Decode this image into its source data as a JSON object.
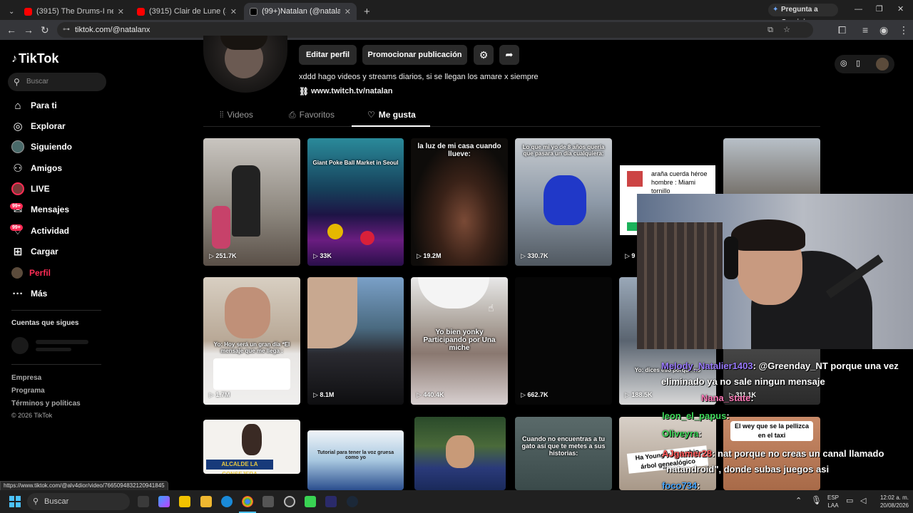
{
  "browser": {
    "tabs": [
      {
        "title": "(3915) The Drums-I need a Do..."
      },
      {
        "title": "(3915) Clair de Lune (Studio Ve..."
      },
      {
        "title": "(99+)Natalan (@natalanx) | TikT..."
      }
    ],
    "new_tab": "+",
    "gemini": "Pregunta a Gemini",
    "url": "tiktok.com/@natalanx"
  },
  "tiktok": {
    "logo": "TikTok",
    "search_placeholder": "Buscar",
    "nav": [
      "Para ti",
      "Explorar",
      "Siguiendo",
      "Amigos",
      "LIVE",
      "Mensajes",
      "Actividad",
      "Cargar",
      "Perfil",
      "Más"
    ],
    "badge": "99+",
    "following_title": "Cuentas que sigues",
    "footer": [
      "Empresa",
      "Programa",
      "Términos y políticas",
      "© 2026 TikTok"
    ]
  },
  "profile": {
    "edit": "Editar perfil",
    "promote": "Promocionar publicación",
    "bio": "xddd hago videos y streams diarios, si se llegan los amare x siempre",
    "link": "www.twitch.tv/natalan",
    "tabs": [
      "Videos",
      "Favoritos",
      "Me gusta"
    ]
  },
  "grid": {
    "row1": [
      {
        "v": "251.7K",
        "cap": ""
      },
      {
        "v": "33K",
        "cap": "Giant Poke Ball Market in Seoul"
      },
      {
        "v": "19.2M",
        "cap": "la luz de mi casa cuando llueve:"
      },
      {
        "v": "330.7K",
        "cap": "Lo que mi yo de 8 años quería que pasara un día cualquiera:"
      },
      {
        "v": "9",
        "cap": "araña cuerda héroe hombre : Miami tornillo"
      }
    ],
    "row2": [
      {
        "v": "1.7M",
        "cap": "Yo: Hoy será un gran día *El mensaje que me llega :"
      },
      {
        "v": "8.1M",
        "cap": ""
      },
      {
        "v": "440.4K",
        "cap": "Yo bien yonky Participando por Una miche"
      },
      {
        "v": "662.7K",
        "cap": ""
      },
      {
        "v": "188.5K",
        "cap": "Yo: dices eso porque no"
      },
      {
        "v": "311.1K",
        "cap": ""
      }
    ],
    "row3": [
      {
        "cap": "ALCALDE LA CONSEJERA"
      },
      {
        "cap": "Tutorial para tener la voz gruesa como yo"
      },
      {
        "cap": ""
      },
      {
        "cap": "Cuando no encuentras a tu gato así que te metes a sus historias:"
      },
      {
        "cap": "Ha Young y su turbio árbol genealógico"
      },
      {
        "cap": "El wey que se la pellizca en el taxi"
      }
    ]
  },
  "chat": [
    {
      "user": "Melody_Natalier1403",
      "text": ": @Greenday_NT porque una vez eliminado ya no sale ningun mensaje"
    },
    {
      "user": "Nana_state",
      "text": ":"
    },
    {
      "user": "leon_el_papus",
      "text": ":"
    },
    {
      "user": "Oliveyra",
      "text": ":"
    },
    {
      "user": "AJgamer28",
      "text": ": nat porque no creas un canal llamado \"natandroid\", donde subas juegos asi"
    },
    {
      "user": "foco734",
      "text": ":"
    }
  ],
  "status_url": "https://www.tiktok.com/@alv4dior/video/7665094832120941845",
  "taskbar": {
    "search": "Buscar",
    "lang": "ESP",
    "lang2": "LAA",
    "time": "12:02 a. m.",
    "date": "20/08/2026"
  },
  "colors": {
    "accent": "#fe2c55",
    "link": "#25f4ee"
  }
}
